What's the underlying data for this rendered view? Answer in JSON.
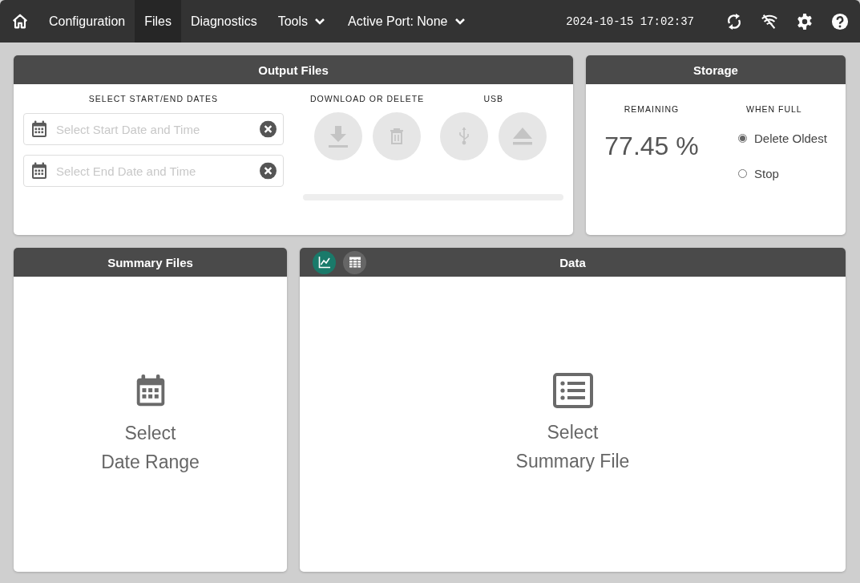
{
  "nav": {
    "items": [
      {
        "label": "Configuration",
        "selected": false,
        "dropdown": false
      },
      {
        "label": "Files",
        "selected": true,
        "dropdown": false
      },
      {
        "label": "Diagnostics",
        "selected": false,
        "dropdown": false
      },
      {
        "label": "Tools",
        "selected": false,
        "dropdown": true
      },
      {
        "label": "Active Port: None",
        "selected": false,
        "dropdown": true
      }
    ],
    "datetime": "2024-10-15 17:02:37"
  },
  "output_files": {
    "title": "Output Files",
    "dates_heading": "SELECT START/END DATES",
    "start_field": {
      "placeholder": "Select Start Date and Time"
    },
    "end_field": {
      "placeholder": "Select End Date and Time"
    },
    "download_heading": "DOWNLOAD OR DELETE",
    "usb_heading": "USB",
    "buttons_disabled": true,
    "progress": {
      "level": 0
    }
  },
  "storage": {
    "title": "Storage",
    "remaining_heading": "REMAINING",
    "remaining": "77.45 %",
    "when_full_heading": "WHEN FULL",
    "options": [
      {
        "label": "Delete Oldest",
        "selected": true
      },
      {
        "label": "Stop",
        "selected": false
      }
    ]
  },
  "summary_files": {
    "title": "Summary Files",
    "prompt": [
      "Select",
      "Date Range"
    ]
  },
  "data": {
    "title": "Data",
    "views": [
      {
        "kind": "chart",
        "selected": true
      },
      {
        "kind": "table",
        "selected": false
      }
    ],
    "prompt": [
      "Select",
      "Summary File"
    ]
  }
}
